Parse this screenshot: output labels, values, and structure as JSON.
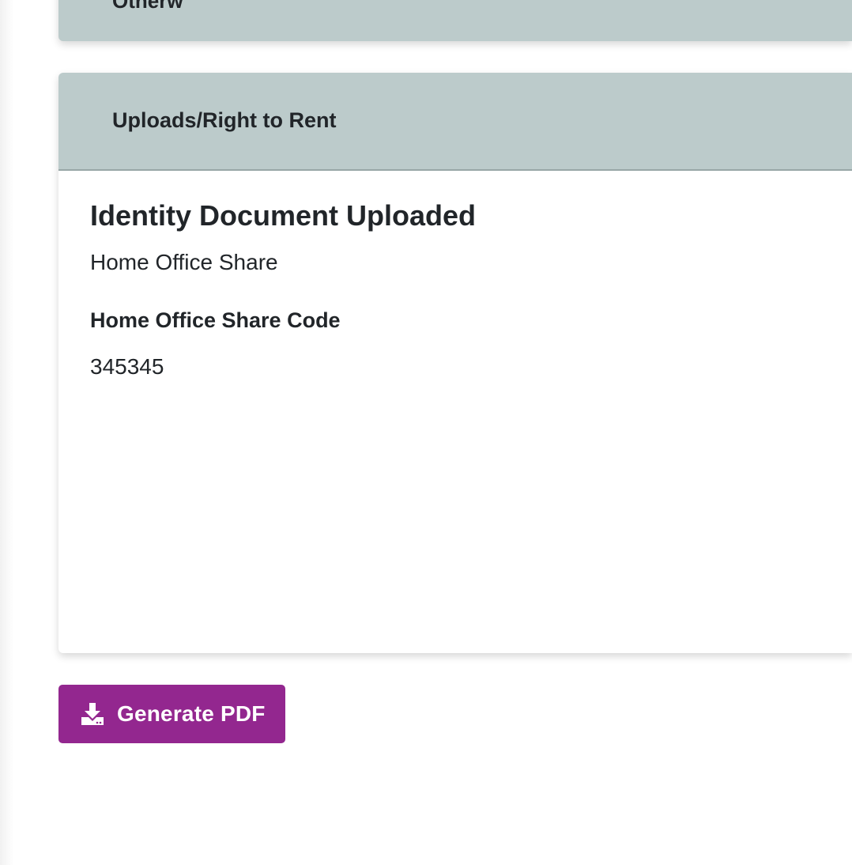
{
  "top_card": {
    "cut_text": "Otherw"
  },
  "uploads_card": {
    "header_title": "Uploads/Right to Rent",
    "document_title": "Identity Document Uploaded",
    "document_type": "Home Office Share",
    "share_code_label": "Home Office Share Code",
    "share_code_value": "345345"
  },
  "actions": {
    "generate_pdf_label": "Generate PDF",
    "generate_pdf_icon": "download-icon"
  },
  "colors": {
    "card_header": "#bccbcb",
    "button": "#93278f",
    "text": "#212529"
  }
}
